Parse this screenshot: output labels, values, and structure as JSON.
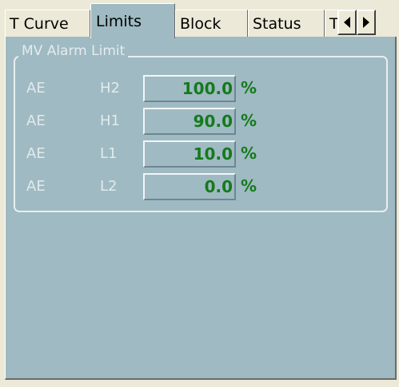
{
  "tabs": [
    {
      "label": "T Curve",
      "active": false
    },
    {
      "label": "Limits",
      "active": true
    },
    {
      "label": "Block",
      "active": false
    },
    {
      "label": "Status",
      "active": false
    },
    {
      "label": "T",
      "active": false
    }
  ],
  "tab_scroll": {
    "left_icon": "arrow-left-icon",
    "right_icon": "arrow-right-icon"
  },
  "group": {
    "title": "MV Alarm Limit",
    "rows": [
      {
        "status": "AE",
        "limit": "H2",
        "value": "100.0",
        "unit": "%"
      },
      {
        "status": "AE",
        "limit": "H1",
        "value": "90.0",
        "unit": "%"
      },
      {
        "status": "AE",
        "limit": "L1",
        "value": "10.0",
        "unit": "%"
      },
      {
        "status": "AE",
        "limit": "L2",
        "value": "0.0",
        "unit": "%"
      }
    ]
  },
  "colors": {
    "panel": "#9fbac3",
    "value_text": "#157a1b",
    "label_text": "#e2eaed"
  }
}
